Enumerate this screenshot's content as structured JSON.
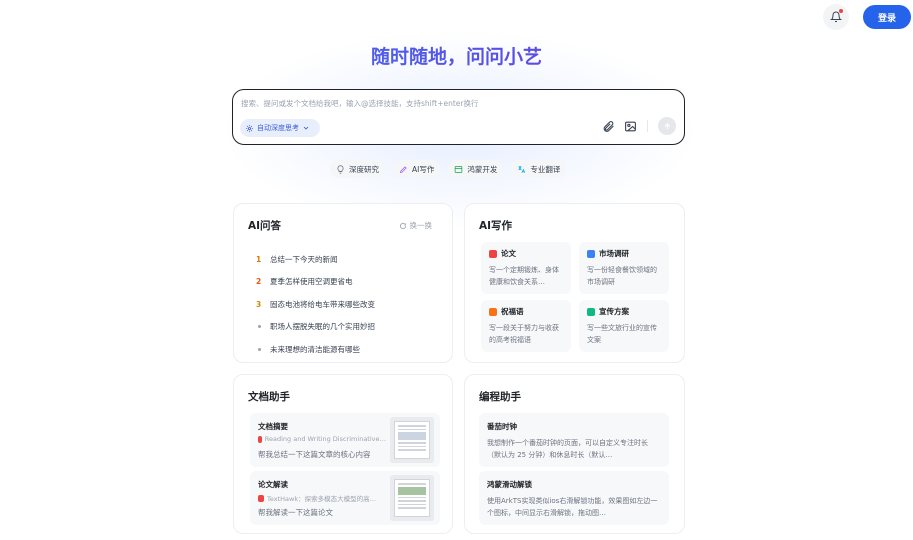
{
  "header": {
    "login_label": "登录"
  },
  "hero": {
    "title": "随时随地，问问小艺"
  },
  "input": {
    "placeholder": "搜索、提问或发个文档给我吧，输入@选择技能，支持shift+enter换行",
    "think_label": "自动深度思考"
  },
  "quick_actions": [
    {
      "label": "深度研究",
      "icon": "lightbulb-icon"
    },
    {
      "label": "AI写作",
      "icon": "pen-icon"
    },
    {
      "label": "鸿蒙开发",
      "icon": "code-window-icon"
    },
    {
      "label": "专业翻译",
      "icon": "translate-icon"
    }
  ],
  "qa_card": {
    "title": "AI问答",
    "refresh_label": "换一换",
    "items": [
      {
        "num": "1",
        "text": "总结一下今天的新闻",
        "color": "#d97706"
      },
      {
        "num": "2",
        "text": "夏季怎样使用空调更省电",
        "color": "#ea580c"
      },
      {
        "num": "3",
        "text": "固态电池将给电车带来哪些改变",
        "color": "#ca8a04"
      },
      {
        "num": "",
        "text": "职场人摆脱失眠的几个实用妙招"
      },
      {
        "num": "",
        "text": "未来理想的清洁能源有哪些"
      }
    ]
  },
  "writing_card": {
    "title": "AI写作",
    "items": [
      {
        "title": "论文",
        "desc": "写一个定期锻炼、身体健康和饮食关系…",
        "color": "#ef4444"
      },
      {
        "title": "市场调研",
        "desc": "写一份轻食餐饮领域的市场调研",
        "color": "#3b82f6"
      },
      {
        "title": "祝福语",
        "desc": "写一段关于努力与收获的高考祝福语",
        "color": "#f97316"
      },
      {
        "title": "宣传方案",
        "desc": "写一些文旅行业的宣传文案",
        "color": "#10b981"
      }
    ]
  },
  "doc_card": {
    "title": "文档助手",
    "items": [
      {
        "title": "文档摘要",
        "file": "Reading and Writing Discriminative…",
        "ask": "帮我总结一下这篇文章的核心内容"
      },
      {
        "title": "论文解读",
        "file": "TextHawk：探索多模态大模型的高…",
        "ask": "帮我解读一下这篇论文"
      }
    ]
  },
  "code_card": {
    "title": "编程助手",
    "items": [
      {
        "title": "番茄时钟",
        "desc": "我想制作一个番茄时钟的页面，可以自定义专注时长（默认为 25 分钟）和休息时长（默认…"
      },
      {
        "title": "鸿蒙滑动解锁",
        "desc": "使用ArkTS实现类似ios右滑解锁功能，效果图如左边一个图标，中间显示右滑解锁，拖动图…"
      }
    ]
  }
}
